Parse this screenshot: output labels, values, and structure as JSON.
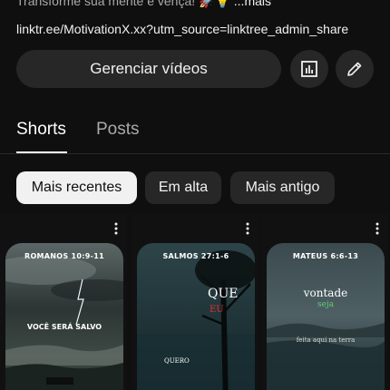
{
  "header": {
    "description_text": "Transforme sua mente e vença! 🚀💡",
    "more_label": " ...mais",
    "link_text": "linktr.ee/MotivationX.xx?utm_source=linktree_admin_share"
  },
  "actions": {
    "manage_label": "Gerenciar vídeos",
    "analytics_icon": "bar-chart-icon",
    "edit_icon": "pencil-icon"
  },
  "tabs": [
    {
      "label": "Shorts",
      "active": true
    },
    {
      "label": "Posts",
      "active": false
    }
  ],
  "filters": [
    {
      "label": "Mais recentes",
      "selected": true
    },
    {
      "label": "Em alta",
      "selected": false
    },
    {
      "label": "Mais antigo",
      "selected": false
    }
  ],
  "shorts": [
    {
      "title": "ROMANOS 10:9-11",
      "caption": "VOCÊ SERÁ SALVO"
    },
    {
      "title": "SALMOS 27:1-6",
      "word1": "QUE",
      "word2": "EU",
      "word3": "QUERO"
    },
    {
      "title": "MATEUS 6:6-13",
      "word1": "vontade",
      "word2": "seja",
      "phrase_start": "feita aqui na ",
      "phrase_end": "terra"
    }
  ],
  "colors": {
    "background": "#0f0f0f",
    "button_bg": "#272727",
    "chip_selected_bg": "#f1f1f1",
    "accent_red": "#e13030",
    "accent_green": "#5fce7a"
  }
}
